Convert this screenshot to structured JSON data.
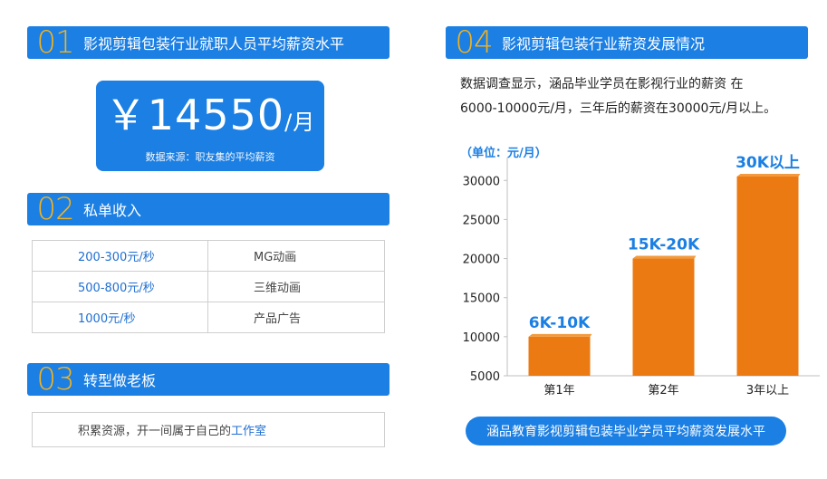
{
  "sections": {
    "s1": {
      "num": "01",
      "title": "影视剪辑包装行业就职人员平均薪资水平"
    },
    "s2": {
      "num": "02",
      "title": "私单收入"
    },
    "s3": {
      "num": "03",
      "title": "转型做老板"
    },
    "s4": {
      "num": "04",
      "title": "影视剪辑包装行业薪资发展情况"
    }
  },
  "salary": {
    "amount": "￥14550",
    "unit": "/月",
    "source": "数据来源：职友集的平均薪资"
  },
  "income_rows": [
    {
      "price": "200-300元/秒",
      "category": "MG动画"
    },
    {
      "price": "500-800元/秒",
      "category": "三维动画"
    },
    {
      "price": "1000元/秒",
      "category": "产品广告"
    }
  ],
  "transform": {
    "text": "积累资源，开一间属于自己的",
    "highlight": "工作室"
  },
  "intro": {
    "line1": "数据调查显示，涵品毕业学员在影视行业的薪资 在",
    "line2": "6000-10000元/月，三年后的薪资在30000元/月以上。"
  },
  "chart_data": {
    "type": "bar",
    "unit_label": "（单位：元/月）",
    "categories": [
      "第1年",
      "第2年",
      "3年以上"
    ],
    "values": [
      10000,
      20000,
      30500
    ],
    "data_labels": [
      "6K-10K",
      "15K-20K",
      "30K以上"
    ],
    "y_ticks": [
      "5000",
      "10000",
      "15000",
      "20000",
      "25000",
      "30000"
    ],
    "ylim": [
      5000,
      32000
    ],
    "bar_color": "#ec7a12",
    "label_color": "#1b7fe3",
    "grid": false
  },
  "caption": "涵品教育影视剪辑包装毕业学员平均薪资发展水平"
}
